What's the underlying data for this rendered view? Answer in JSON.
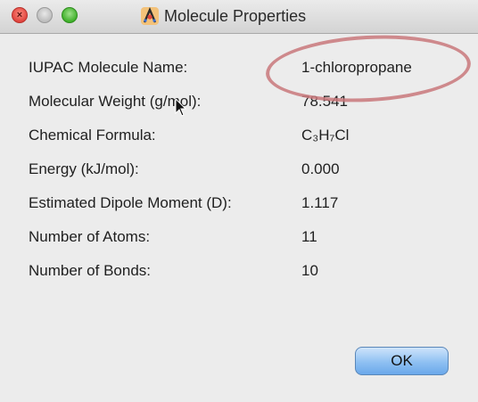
{
  "window": {
    "title": "Molecule Properties",
    "app_icon": "avogadro-app-icon"
  },
  "properties": [
    {
      "label": "IUPAC Molecule Name:",
      "value": "1-chloropropane"
    },
    {
      "label": "Molecular Weight (g/mol):",
      "value": "78.541"
    },
    {
      "label": "Chemical Formula:",
      "value": "C₃H₇Cl"
    },
    {
      "label": "Energy (kJ/mol):",
      "value": "0.000"
    },
    {
      "label": "Estimated Dipole Moment (D):",
      "value": "1.117"
    },
    {
      "label": "Number of Atoms:",
      "value": "11"
    },
    {
      "label": "Number of Bonds:",
      "value": "10"
    }
  ],
  "buttons": {
    "ok_label": "OK"
  },
  "colors": {
    "highlight_ellipse": "#c9787b",
    "ok_button_accent": "#8ec0f2",
    "close_button": "#e0443e",
    "zoom_button": "#3fb02a"
  }
}
